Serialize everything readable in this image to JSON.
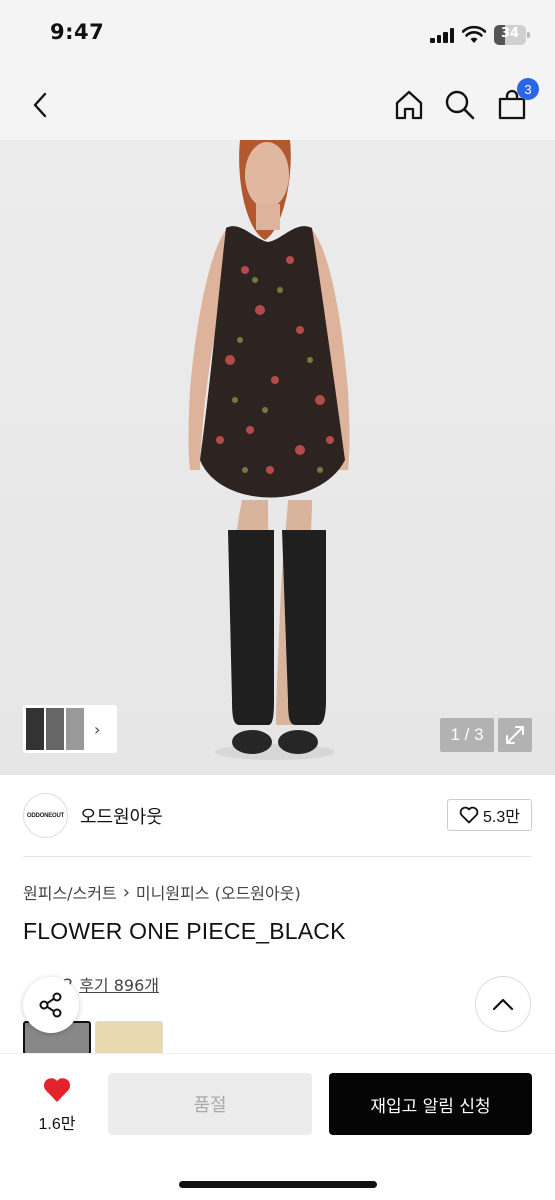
{
  "status": {
    "time": "9:47",
    "battery": "34",
    "battery_level": 0.34
  },
  "nav": {
    "back_icon": "chevron-left-icon",
    "home_icon": "home-icon",
    "search_icon": "search-icon",
    "cart_icon": "shopping-bag-icon",
    "cart_count": "3"
  },
  "gallery": {
    "counter": "1 / 3",
    "expand_icon": "expand-icon"
  },
  "brand": {
    "logo_text": "ODDONEOUT",
    "name": "오드원아웃",
    "likes": "5.3만"
  },
  "product": {
    "category_path": [
      "원피스/스커트",
      "미니원피스 (오드원아웃)"
    ],
    "title": "FLOWER ONE PIECE_BLACK",
    "rating_partial": "2",
    "review_label": "후기 896개"
  },
  "bottom": {
    "wish_count": "1.6만",
    "sold_out_label": "품절",
    "restock_label": "재입고 알림 신청"
  },
  "colors": {
    "accent_badge": "#2a66e6",
    "heart": "#e3232b",
    "cta": "#050505"
  }
}
